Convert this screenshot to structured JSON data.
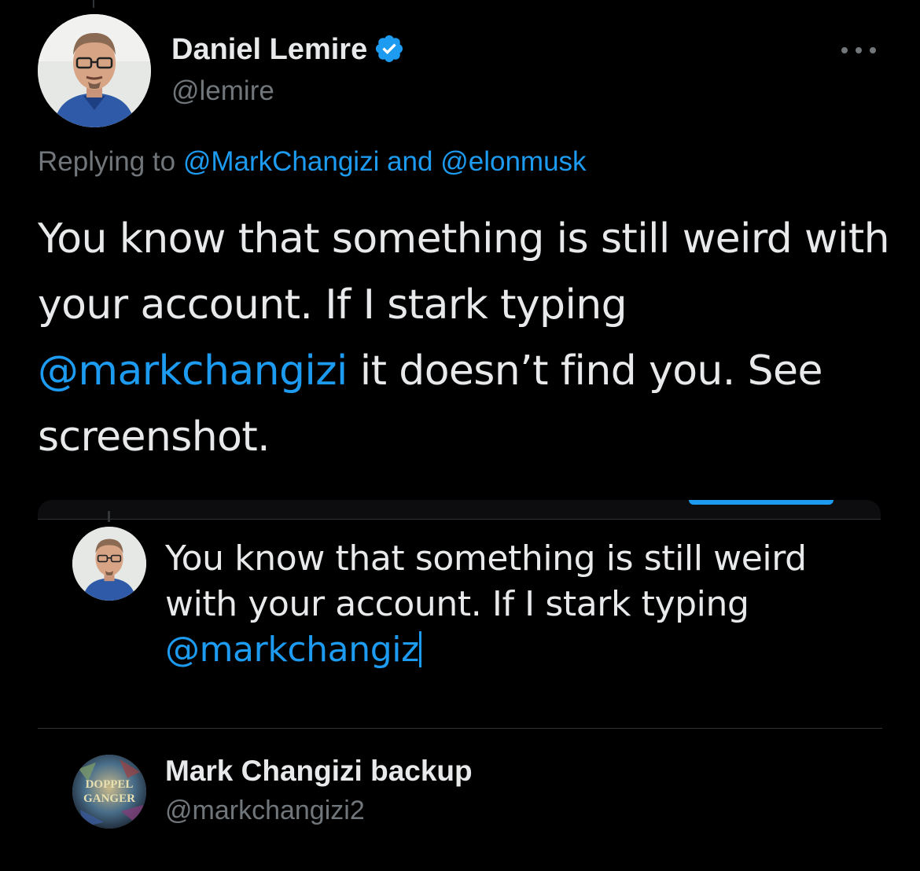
{
  "tweet": {
    "author_name": "Daniel Lemire",
    "author_handle": "@lemire",
    "replying_prefix": "Replying to",
    "reply_to_1": "@MarkChangizi",
    "reply_joiner": "and",
    "reply_to_2": "@elonmusk",
    "body_part1": "You know that something is still weird with your account. If I stark typing",
    "body_mention": "@markchangizi",
    "body_part2": "it doesn’t find you. See screenshot."
  },
  "screenshot": {
    "compose_text": "You know that something is still weird with your account. If I stark typing",
    "compose_mention": "@markchangiz",
    "suggestion": {
      "name": "Mark Changizi backup",
      "handle": "@markchangizi2",
      "avatar_text_line1": "DOPPEL",
      "avatar_text_line2": "GANGER"
    }
  },
  "icons": {
    "verified": "verified-badge-icon",
    "more": "more-dots-icon"
  },
  "colors": {
    "background": "#000000",
    "text": "#e7e9ea",
    "muted": "#71767b",
    "accent": "#1d9bf0",
    "divider": "#2f3336"
  }
}
